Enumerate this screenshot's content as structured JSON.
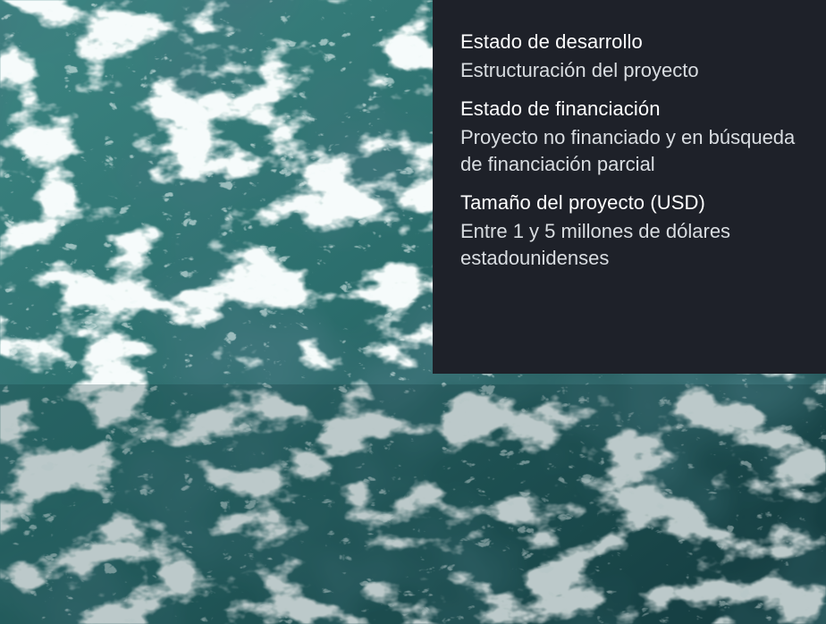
{
  "image": {
    "description": "aerial-ocean-foam-texture",
    "colors": {
      "deep": "#163f42",
      "mid": "#2f7473",
      "light": "#5c9e9b",
      "foam": "#e6f2f1"
    }
  },
  "card": {
    "background": "#1e2129",
    "items": [
      {
        "label": "Estado de desarrollo",
        "value": "Estructuración del proyecto"
      },
      {
        "label": "Estado de financiación",
        "value": "Proyecto no financiado y en búsqueda de financiación parcial"
      },
      {
        "label": "Tamaño del proyecto (USD)",
        "value": "Entre 1 y 5 millones de dólares estadounidenses"
      }
    ]
  }
}
